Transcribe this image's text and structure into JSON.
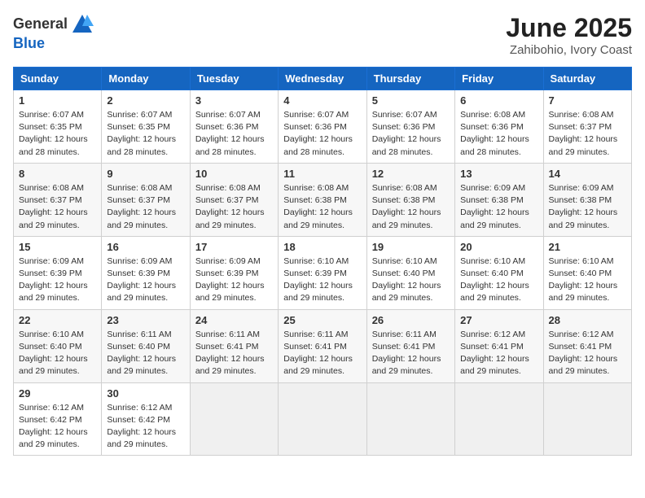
{
  "header": {
    "logo_general": "General",
    "logo_blue": "Blue",
    "month_title": "June 2025",
    "location": "Zahibohio, Ivory Coast"
  },
  "days_of_week": [
    "Sunday",
    "Monday",
    "Tuesday",
    "Wednesday",
    "Thursday",
    "Friday",
    "Saturday"
  ],
  "weeks": [
    [
      {
        "day": 1,
        "sunrise": "6:07 AM",
        "sunset": "6:35 PM",
        "daylight": "12 hours and 28 minutes."
      },
      {
        "day": 2,
        "sunrise": "6:07 AM",
        "sunset": "6:35 PM",
        "daylight": "12 hours and 28 minutes."
      },
      {
        "day": 3,
        "sunrise": "6:07 AM",
        "sunset": "6:36 PM",
        "daylight": "12 hours and 28 minutes."
      },
      {
        "day": 4,
        "sunrise": "6:07 AM",
        "sunset": "6:36 PM",
        "daylight": "12 hours and 28 minutes."
      },
      {
        "day": 5,
        "sunrise": "6:07 AM",
        "sunset": "6:36 PM",
        "daylight": "12 hours and 28 minutes."
      },
      {
        "day": 6,
        "sunrise": "6:08 AM",
        "sunset": "6:36 PM",
        "daylight": "12 hours and 28 minutes."
      },
      {
        "day": 7,
        "sunrise": "6:08 AM",
        "sunset": "6:37 PM",
        "daylight": "12 hours and 29 minutes."
      }
    ],
    [
      {
        "day": 8,
        "sunrise": "6:08 AM",
        "sunset": "6:37 PM",
        "daylight": "12 hours and 29 minutes."
      },
      {
        "day": 9,
        "sunrise": "6:08 AM",
        "sunset": "6:37 PM",
        "daylight": "12 hours and 29 minutes."
      },
      {
        "day": 10,
        "sunrise": "6:08 AM",
        "sunset": "6:37 PM",
        "daylight": "12 hours and 29 minutes."
      },
      {
        "day": 11,
        "sunrise": "6:08 AM",
        "sunset": "6:38 PM",
        "daylight": "12 hours and 29 minutes."
      },
      {
        "day": 12,
        "sunrise": "6:08 AM",
        "sunset": "6:38 PM",
        "daylight": "12 hours and 29 minutes."
      },
      {
        "day": 13,
        "sunrise": "6:09 AM",
        "sunset": "6:38 PM",
        "daylight": "12 hours and 29 minutes."
      },
      {
        "day": 14,
        "sunrise": "6:09 AM",
        "sunset": "6:38 PM",
        "daylight": "12 hours and 29 minutes."
      }
    ],
    [
      {
        "day": 15,
        "sunrise": "6:09 AM",
        "sunset": "6:39 PM",
        "daylight": "12 hours and 29 minutes."
      },
      {
        "day": 16,
        "sunrise": "6:09 AM",
        "sunset": "6:39 PM",
        "daylight": "12 hours and 29 minutes."
      },
      {
        "day": 17,
        "sunrise": "6:09 AM",
        "sunset": "6:39 PM",
        "daylight": "12 hours and 29 minutes."
      },
      {
        "day": 18,
        "sunrise": "6:10 AM",
        "sunset": "6:39 PM",
        "daylight": "12 hours and 29 minutes."
      },
      {
        "day": 19,
        "sunrise": "6:10 AM",
        "sunset": "6:40 PM",
        "daylight": "12 hours and 29 minutes."
      },
      {
        "day": 20,
        "sunrise": "6:10 AM",
        "sunset": "6:40 PM",
        "daylight": "12 hours and 29 minutes."
      },
      {
        "day": 21,
        "sunrise": "6:10 AM",
        "sunset": "6:40 PM",
        "daylight": "12 hours and 29 minutes."
      }
    ],
    [
      {
        "day": 22,
        "sunrise": "6:10 AM",
        "sunset": "6:40 PM",
        "daylight": "12 hours and 29 minutes."
      },
      {
        "day": 23,
        "sunrise": "6:11 AM",
        "sunset": "6:40 PM",
        "daylight": "12 hours and 29 minutes."
      },
      {
        "day": 24,
        "sunrise": "6:11 AM",
        "sunset": "6:41 PM",
        "daylight": "12 hours and 29 minutes."
      },
      {
        "day": 25,
        "sunrise": "6:11 AM",
        "sunset": "6:41 PM",
        "daylight": "12 hours and 29 minutes."
      },
      {
        "day": 26,
        "sunrise": "6:11 AM",
        "sunset": "6:41 PM",
        "daylight": "12 hours and 29 minutes."
      },
      {
        "day": 27,
        "sunrise": "6:12 AM",
        "sunset": "6:41 PM",
        "daylight": "12 hours and 29 minutes."
      },
      {
        "day": 28,
        "sunrise": "6:12 AM",
        "sunset": "6:41 PM",
        "daylight": "12 hours and 29 minutes."
      }
    ],
    [
      {
        "day": 29,
        "sunrise": "6:12 AM",
        "sunset": "6:42 PM",
        "daylight": "12 hours and 29 minutes."
      },
      {
        "day": 30,
        "sunrise": "6:12 AM",
        "sunset": "6:42 PM",
        "daylight": "12 hours and 29 minutes."
      },
      null,
      null,
      null,
      null,
      null
    ]
  ]
}
